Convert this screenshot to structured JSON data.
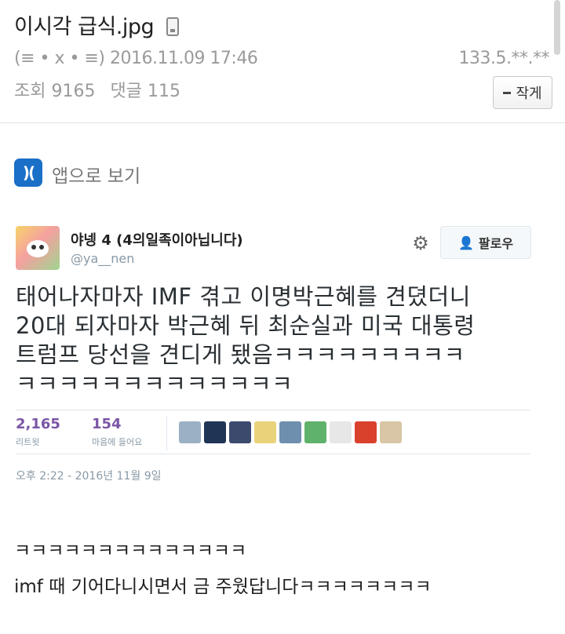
{
  "post": {
    "title": "이시각 급식.jpg",
    "icon": "mobile-phone-icon",
    "meta": "(≡ • x • ≡) 2016.11.09 17:46",
    "ip": "133.5.**.**",
    "views_label": "조회",
    "views": "9165",
    "comments_label": "댓글",
    "comments": "115",
    "author_button": "작게"
  },
  "app_link": {
    "label": "앱으로 보기",
    "icon": ")("
  },
  "tweet": {
    "name": "야넹 4 (4의일족이아닙니다)",
    "handle": "@ya__nen",
    "follow_label": "팔로우",
    "text_lines": [
      "태어나자마자 IMF 겪고 이명박근혜를 견뎠더니",
      "20대 되자마자 박근혜 뒤 최순실과 미국 대통령",
      "트럼프 당선을 견디게 됐음ㅋㅋㅋㅋㅋㅋㅋㅋㅋ",
      "ㅋㅋㅋㅋㅋㅋㅋㅋㅋㅋㅋㅋㅋ"
    ],
    "retweets": "2,165",
    "retweets_label": "리트윗",
    "likes": "154",
    "likes_label": "마음에 들어요",
    "timestamp": "오후 2:22 - 2016년 11월 9일"
  },
  "body": {
    "line1": "ㅋㅋㅋㅋㅋㅋㅋㅋㅋㅋㅋㅋㅋㅋ",
    "line2": "imf 때 기어다니시면서 금 주웠답니다ㅋㅋㅋㅋㅋㅋㅋㅋ"
  },
  "colors": {
    "accent_count": "#7a56a6",
    "app_icon": "#1a6fc7",
    "follow_icon": "#1da1f2"
  }
}
